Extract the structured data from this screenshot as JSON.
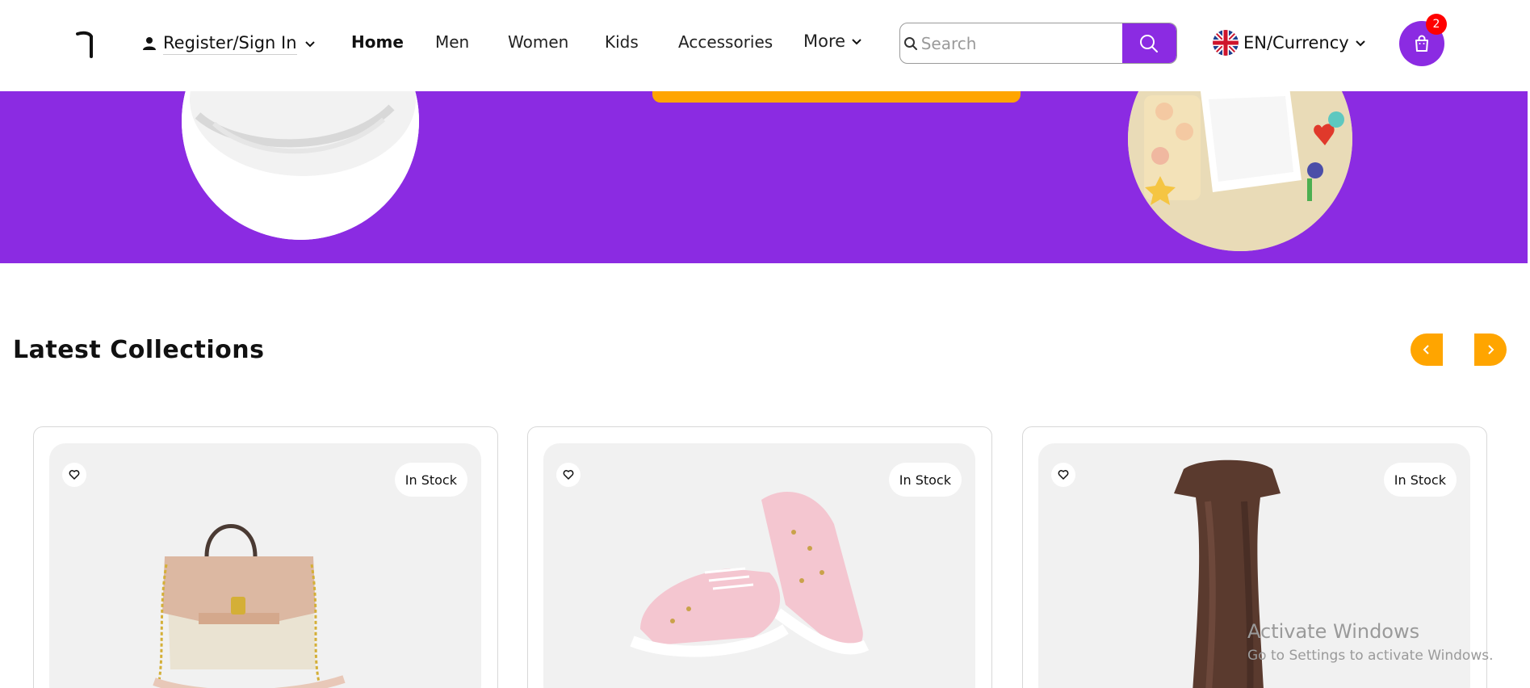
{
  "header": {
    "account_label": "Register/Sign In",
    "nav": {
      "home": "Home",
      "men": "Men",
      "women": "Women",
      "kids": "Kids",
      "accessories": "Accessories",
      "more": "More"
    },
    "search": {
      "placeholder": "Search"
    },
    "language_label": "EN/Currency",
    "cart_count": "2"
  },
  "colors": {
    "brand_purple": "#8b2be2",
    "accent_orange": "#ffa500",
    "badge_red": "#ff0000"
  },
  "icons": [
    "logo-icon",
    "user-icon",
    "chevron-down-icon",
    "search-icon",
    "uk-flag-icon",
    "shopping-bag-icon",
    "heart-icon",
    "chevron-left-icon",
    "chevron-right-icon"
  ],
  "collections": {
    "title": "Latest Collections",
    "products": [
      {
        "stock": "In Stock",
        "image": "handbag"
      },
      {
        "stock": "In Stock",
        "image": "pink-sneakers"
      },
      {
        "stock": "In Stock",
        "image": "bronze-dress"
      }
    ]
  },
  "watermark": {
    "line1": "Activate Windows",
    "line2": "Go to Settings to activate Windows."
  }
}
